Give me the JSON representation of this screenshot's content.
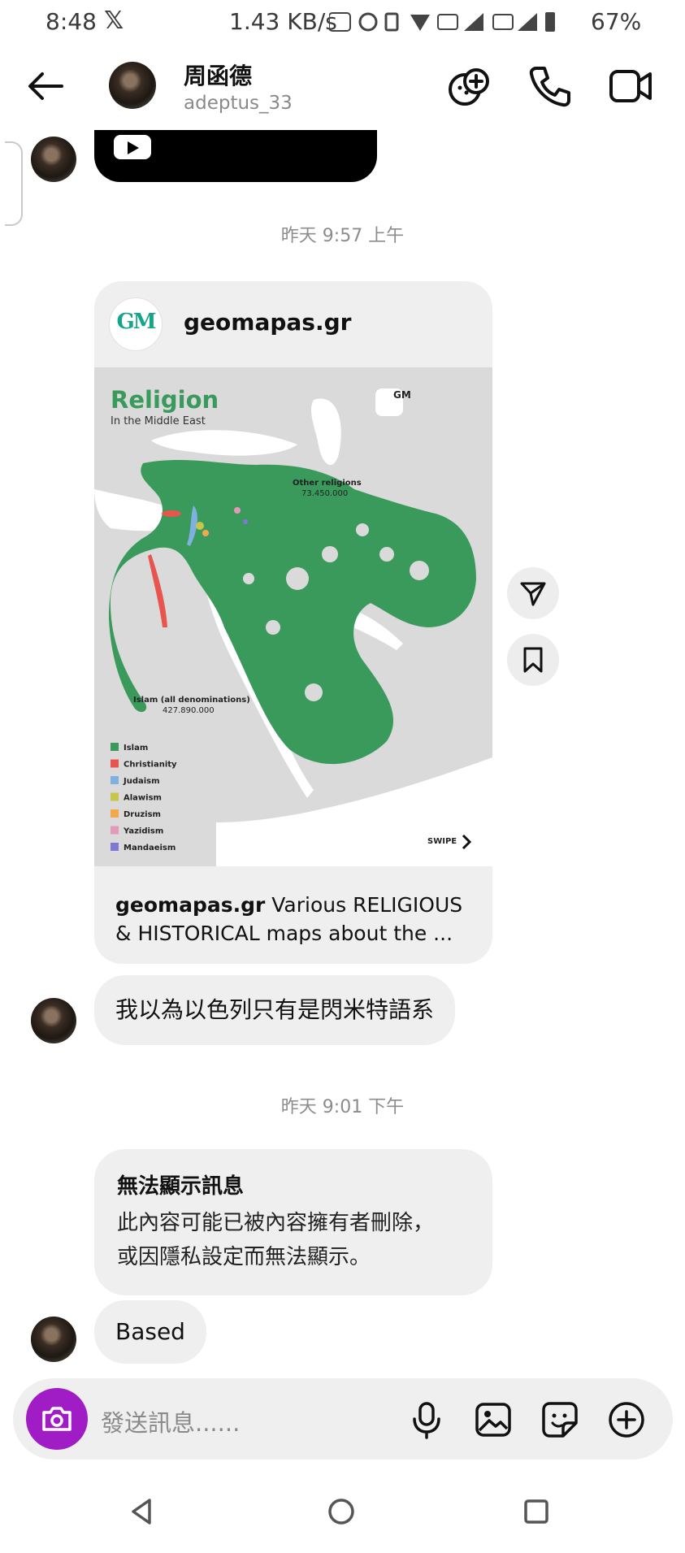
{
  "status": {
    "time": "8:48",
    "x_label": "𝕏",
    "speed": "1.43 KB/s",
    "battery": "67%"
  },
  "header": {
    "name": "周函德",
    "username": "adeptus_33"
  },
  "chat": {
    "timestamp1": "昨天 9:57 上午",
    "card": {
      "logo_text": "GM",
      "account": "geomapas.gr",
      "caption_account": "geomapas.gr",
      "caption_text": " Various RELIGIOUS & HISTORICAL maps about the ..."
    },
    "map": {
      "title": "Religion",
      "subtitle": "In the Middle East",
      "other_label": "Other religions",
      "other_value": "73.450.000",
      "islam_label": "Islam (all denominations)",
      "islam_value": "427.890.000",
      "swipe": "SWIPE",
      "legend": [
        {
          "label": "Islam",
          "color": "#3a9a5c"
        },
        {
          "label": "Christianity",
          "color": "#e8554f"
        },
        {
          "label": "Judaism",
          "color": "#7fb1e0"
        },
        {
          "label": "Alawism",
          "color": "#c5c64a"
        },
        {
          "label": "Druzism",
          "color": "#f3a94b"
        },
        {
          "label": "Yazidism",
          "color": "#e39ab8"
        },
        {
          "label": "Mandaeism",
          "color": "#7f79d3"
        }
      ]
    },
    "message1": "我以為以色列只有是閃米特語系",
    "timestamp2": "昨天 9:01 下午",
    "unavailable_title": "無法顯示訊息",
    "unavailable_line1": "此內容可能已被內容擁有者刪除，",
    "unavailable_line2": "或因隱私設定而無法顯示。",
    "message2": "Based"
  },
  "input": {
    "placeholder": "發送訊息......"
  }
}
